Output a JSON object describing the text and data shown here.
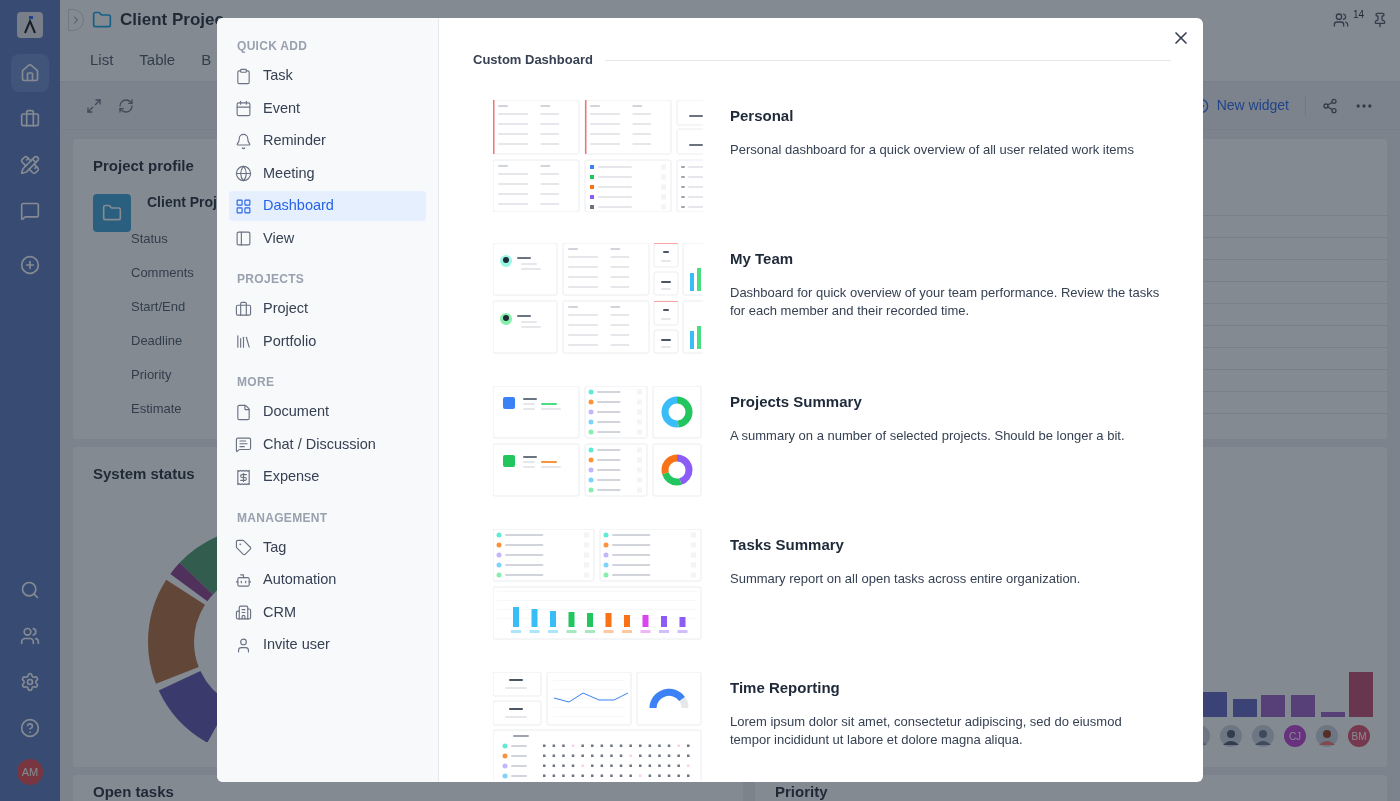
{
  "sidebar": {
    "avatar": "AM"
  },
  "header": {
    "title": "Client Projec",
    "tabs": [
      "List",
      "Table",
      "B"
    ],
    "members_count": "14"
  },
  "toolbar": {
    "new_widget": "New widget"
  },
  "profile": {
    "title": "Project profile",
    "name": "Client Proj",
    "fields": [
      "Status",
      "Comments",
      "Start/End",
      "Deadline",
      "Priority",
      "Estimate"
    ]
  },
  "system_status": {
    "title": "System status"
  },
  "open_tasks": {
    "title": "Open tasks"
  },
  "priority": {
    "title": "Priority"
  },
  "team_avatars": [
    "CJ",
    "BM"
  ],
  "modal": {
    "sections": [
      {
        "title": "QUICK ADD",
        "items": [
          {
            "label": "Task",
            "selected": false
          },
          {
            "label": "Event",
            "selected": false
          },
          {
            "label": "Reminder",
            "selected": false
          },
          {
            "label": "Meeting",
            "selected": false
          },
          {
            "label": "Dashboard",
            "selected": true
          },
          {
            "label": "View",
            "selected": false
          }
        ]
      },
      {
        "title": "PROJECTS",
        "items": [
          {
            "label": "Project",
            "selected": false
          },
          {
            "label": "Portfolio",
            "selected": false
          }
        ]
      },
      {
        "title": "MORE",
        "items": [
          {
            "label": "Document",
            "selected": false
          },
          {
            "label": "Chat / Discussion",
            "selected": false
          },
          {
            "label": "Expense",
            "selected": false
          }
        ]
      },
      {
        "title": "MANAGEMENT",
        "items": [
          {
            "label": "Tag",
            "selected": false
          },
          {
            "label": "Automation",
            "selected": false
          },
          {
            "label": "CRM",
            "selected": false
          },
          {
            "label": "Invite user",
            "selected": false
          }
        ]
      }
    ],
    "heading": "Custom Dashboard",
    "dashboards": [
      {
        "kind": "personal",
        "title": "Personal",
        "description": "Personal dashboard for a quick overview of all user related work items"
      },
      {
        "kind": "team",
        "title": "My Team",
        "description": "Dashboard for quick overview of your team performance. Review the tasks for each member and their recorded time."
      },
      {
        "kind": "projects",
        "title": "Projects Summary",
        "description": "A summary on a number of selected projects. Should be longer a bit."
      },
      {
        "kind": "tasks",
        "title": "Tasks Summary",
        "description": "Summary report on all open tasks across entire organization."
      },
      {
        "kind": "time",
        "title": "Time Reporting",
        "description": "Lorem ipsum dolor sit amet, consectetur adipiscing, sed do eiusmod tempor incididunt ut labore et dolore magna aliqua."
      }
    ]
  }
}
